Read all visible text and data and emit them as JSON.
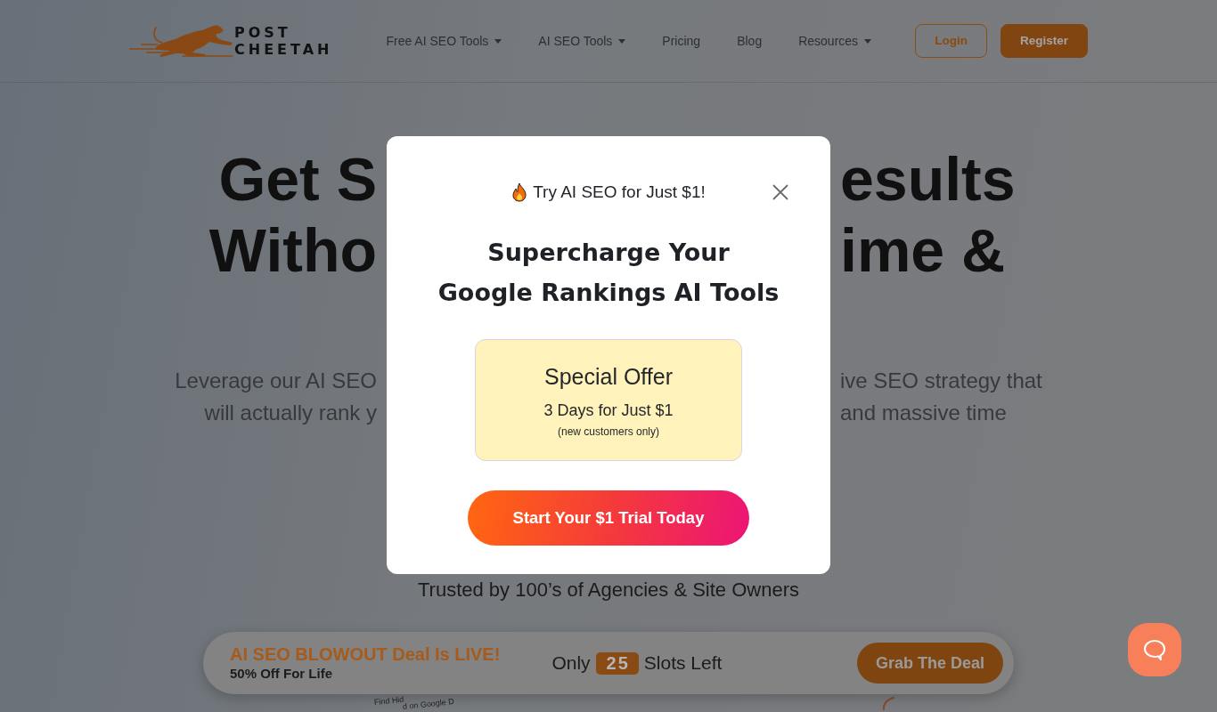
{
  "navbar": {
    "logo_text": [
      "POST",
      "CHEETAH"
    ],
    "menu": [
      {
        "label": "Free AI SEO Tools",
        "dropdown": true
      },
      {
        "label": "AI SEO Tools",
        "dropdown": true
      },
      {
        "label": "Pricing",
        "dropdown": false
      },
      {
        "label": "Blog",
        "dropdown": false
      },
      {
        "label": "Resources",
        "dropdown": true
      }
    ],
    "buttons": [
      {
        "label": "Login",
        "kind": "outline"
      },
      {
        "label": "Register",
        "kind": "filled"
      }
    ]
  },
  "hero": {
    "heading_lines": [
      {
        "left": "Get S",
        "right": "esults"
      },
      {
        "left": "Witho",
        "right": "ime &"
      }
    ],
    "subtext_lines": [
      {
        "left": "Leverage our AI SEO",
        "right": "ive SEO strategy that"
      },
      {
        "left": "will actually rank y",
        "right": "and massive time"
      }
    ],
    "trusted_text": "Trusted by 100’s of Agencies & Site Owners",
    "illustration_texts": [
      "Find Hid",
      "d on Google D"
    ]
  },
  "popup": {
    "eyebrow": "Try AI SEO for Just $1!",
    "title_lines": [
      "Supercharge Your",
      "Google Rankings AI Tools"
    ],
    "offer": {
      "title": "Special Offer",
      "price": "3 Days for Just $1",
      "note": "(new customers only)"
    },
    "button": "Start Your $1 Trial Today"
  },
  "deal_bar": {
    "title": "AI SEO BLOWOUT Deal Is LIVE!",
    "subtitle": "50% Off For Life",
    "slots_before": "Only",
    "slots_count": "25",
    "slots_after": "Slots Left",
    "button": "Grab The Deal"
  }
}
